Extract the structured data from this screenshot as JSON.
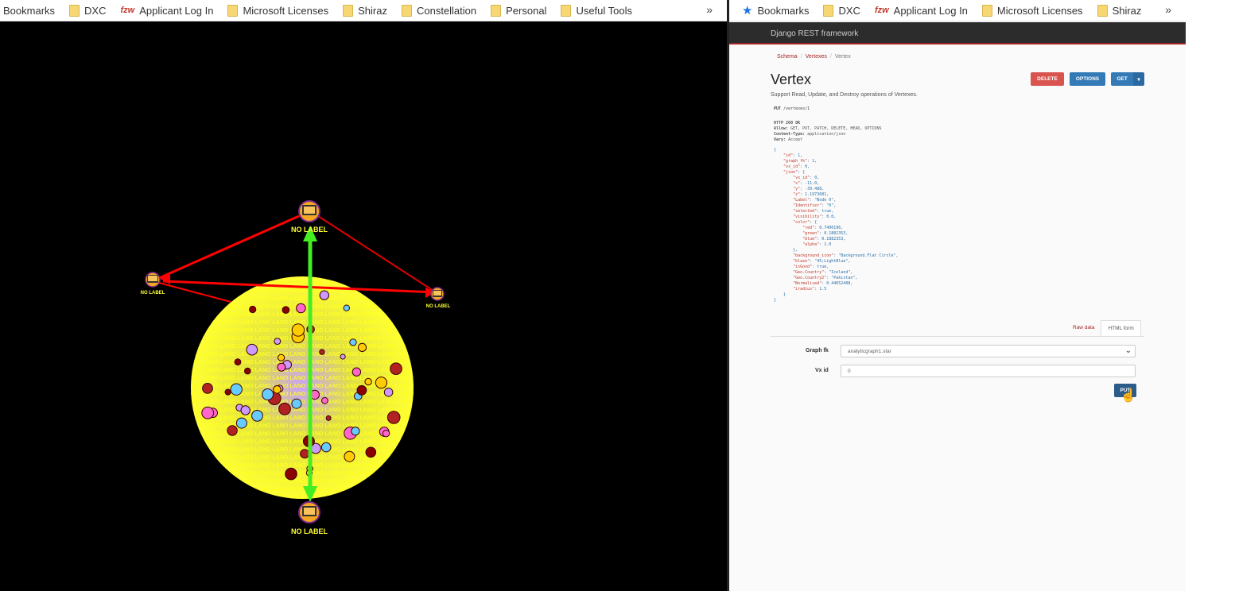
{
  "left_bookmarks": {
    "items": [
      {
        "label": "Bookmarks",
        "icon": "none"
      },
      {
        "label": "DXC",
        "icon": "folder-icon"
      },
      {
        "label": "Applicant Log In",
        "icon": "fzw-icon",
        "prefix": "fzw"
      },
      {
        "label": "Microsoft Licenses",
        "icon": "folder-icon"
      },
      {
        "label": "Shiraz",
        "icon": "folder-icon"
      },
      {
        "label": "Constellation",
        "icon": "folder-icon"
      },
      {
        "label": "Personal",
        "icon": "folder-icon"
      },
      {
        "label": "Useful Tools",
        "icon": "folder-icon"
      }
    ],
    "overflow": "»"
  },
  "right_bookmarks": {
    "items": [
      {
        "label": "Bookmarks",
        "icon": "star-icon"
      },
      {
        "label": "DXC",
        "icon": "folder-icon"
      },
      {
        "label": "Applicant Log In",
        "icon": "fzw-icon",
        "prefix": "fzw"
      },
      {
        "label": "Microsoft Licenses",
        "icon": "folder-icon"
      },
      {
        "label": "Shiraz",
        "icon": "folder-icon"
      }
    ],
    "overflow": "»"
  },
  "graph": {
    "node_label": "NO LABEL",
    "colors": {
      "background": "#000000",
      "edge_red": "#ff0000",
      "edge_green": "#44ee22",
      "node_fill": "#f5a623",
      "cluster": "#ffff33"
    }
  },
  "drf": {
    "brand": "Django REST framework",
    "breadcrumb": [
      "Schema",
      "Vertexes",
      "Vertex"
    ],
    "title": "Vertex",
    "description": "Support Read, Update, and Destroy operations of Vertexes.",
    "buttons": {
      "delete": "DELETE",
      "options": "OPTIONS",
      "get": "GET",
      "put": "PUT"
    },
    "request": {
      "method": "PUT",
      "path": "/vertexes/1"
    },
    "response_headers": {
      "status": "HTTP 200 OK",
      "allow_key": "Allow:",
      "allow": "GET, PUT, PATCH, DELETE, HEAD, OPTIONS",
      "ct_key": "Content-Type:",
      "ct": "application/json",
      "vary_key": "Vary:",
      "vary": "Accept"
    },
    "json_lines": [
      "{",
      "    \"id\": 1,",
      "    \"graph_fk\": 1,",
      "    \"vx_id\": 0,",
      "    \"json\": {",
      "        \"vx_id\": 0,",
      "        \"x\": -11.0,",
      "        \"y\": -39.488,",
      "        \"z\": 1.1973681,",
      "        \"Label\": \"Node 0\",",
      "        \"Identifier\": \"0\",",
      "        \"selected\": true,",
      "        \"visibility\": 0.0,",
      "        \"color\": {",
      "            \"red\": 0.7490196,",
      "            \"green\": 0.1882353,",
      "            \"blue\": 0.1882353,",
      "            \"alpha\": 1.0",
      "        },",
      "        \"background_icon\": \"Background.Flat Circle\",",
      "        \"blaze\": \"45;LightBlue\",",
      "        \"isGood\": true,",
      "        \"Geo.Country\": \"Iceland\",",
      "        \"Geo.Country2\": \"Pakistan\",",
      "        \"Normalised\": 0.44652408,",
      "        \"iradius\": 1.5",
      "    }",
      "}"
    ],
    "tabs": {
      "raw": "Raw data",
      "html": "HTML form"
    },
    "form": {
      "graph_fk_label": "Graph fk",
      "graph_fk_value": "analyticgraph1.star",
      "vx_id_label": "Vx id",
      "vx_id_value": "0"
    }
  }
}
